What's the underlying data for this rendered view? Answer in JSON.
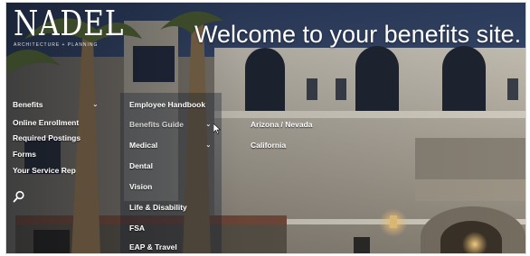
{
  "logo": {
    "word": "NADEL",
    "sub": "ARCHITECTURE + PLANNING"
  },
  "hero": {
    "title": "Welcome to your benefits site."
  },
  "nav": {
    "items": [
      {
        "label": "Benefits",
        "has_submenu": true
      },
      {
        "label": "Online Enrollment"
      },
      {
        "label": "Required Postings"
      },
      {
        "label": "Forms"
      },
      {
        "label": "Your Service Rep"
      }
    ],
    "search_icon": "search-icon"
  },
  "benefits_menu": {
    "items": [
      {
        "label": "Employee Handbook"
      },
      {
        "label": "Benefits Guide",
        "has_submenu": true
      },
      {
        "label": "Medical",
        "has_submenu": true
      },
      {
        "label": "Dental"
      },
      {
        "label": "Vision"
      },
      {
        "label": "Life & Disability"
      },
      {
        "label": "FSA"
      },
      {
        "label": "EAP & Travel"
      }
    ]
  },
  "guide_menu": {
    "items": [
      {
        "label": "Arizona / Nevada"
      },
      {
        "label": "California"
      }
    ]
  },
  "colors": {
    "text": "#ffffff",
    "sky": "#3b4f74",
    "facade": "#b7b1a4"
  }
}
